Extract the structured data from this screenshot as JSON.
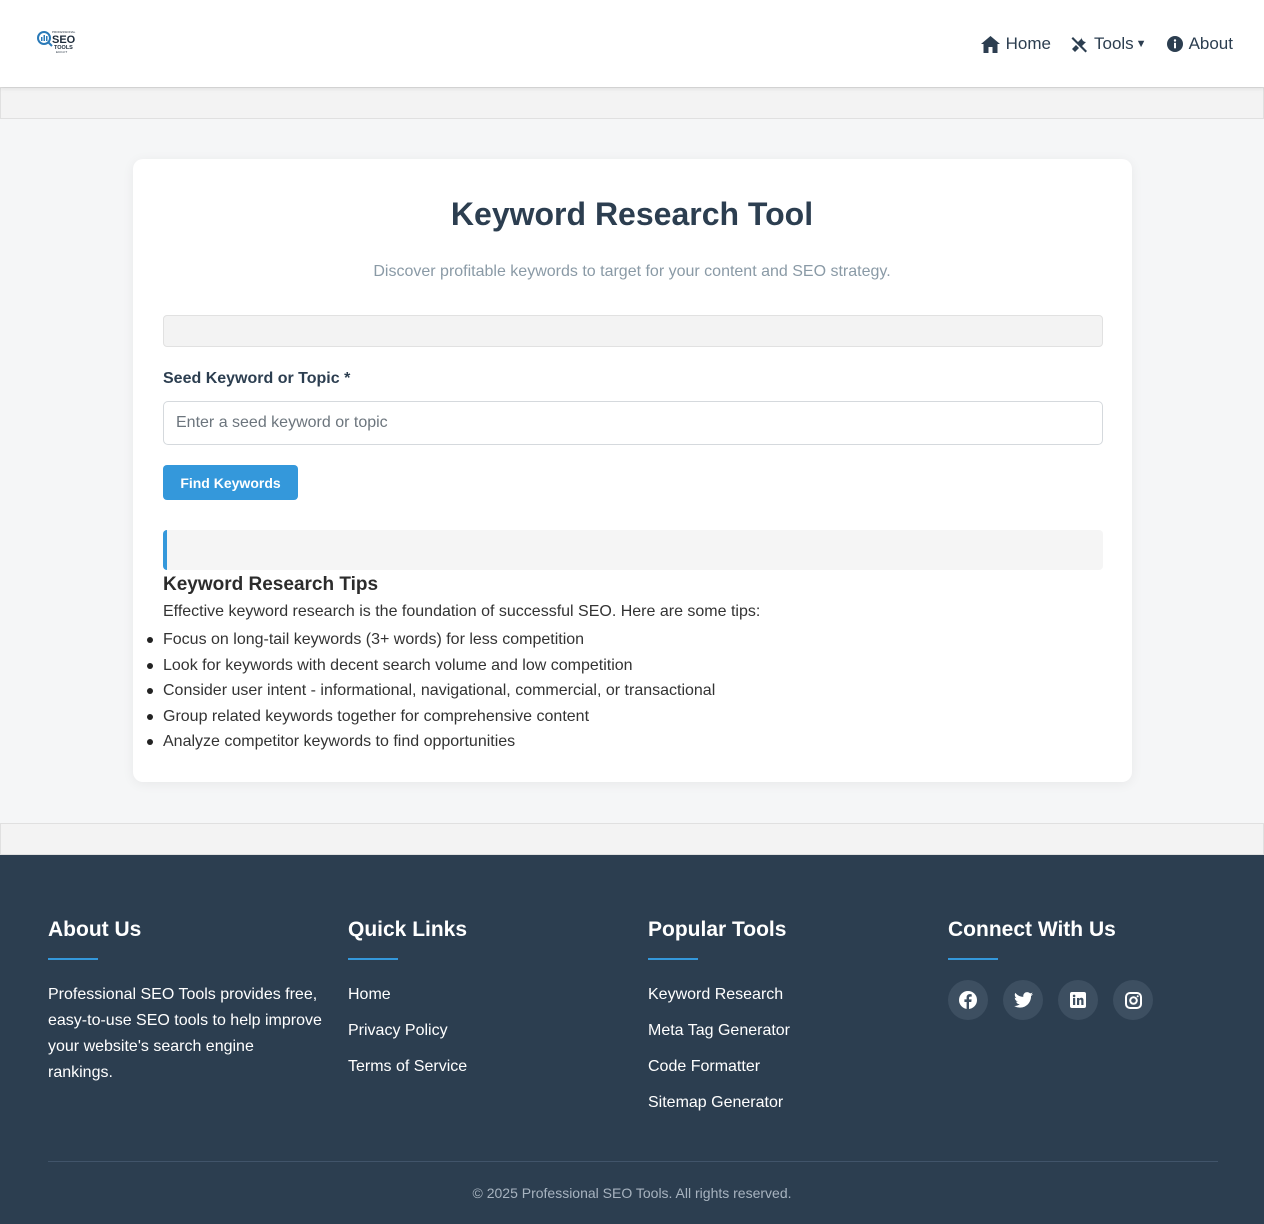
{
  "header": {
    "logo_text": "SEO TOOLS",
    "nav": [
      {
        "label": "Home",
        "icon": "home-icon"
      },
      {
        "label": "Tools",
        "icon": "tools-icon"
      },
      {
        "label": "About",
        "icon": "info-icon"
      }
    ]
  },
  "main": {
    "title": "Keyword Research Tool",
    "subtitle": "Discover profitable keywords to target for your content and SEO strategy.",
    "field_label": "Seed Keyword or Topic *",
    "input_placeholder": "Enter a seed keyword or topic",
    "input_value": "",
    "button_label": "Find Keywords",
    "tips": {
      "title": "Keyword Research Tips",
      "intro": "Effective keyword research is the foundation of successful SEO. Here are some tips:",
      "items": [
        "Focus on long-tail keywords (3+ words) for less competition",
        "Look for keywords with decent search volume and low competition",
        "Consider user intent - informational, navigational, commercial, or transactional",
        "Group related keywords together for comprehensive content",
        "Analyze competitor keywords to find opportunities"
      ]
    }
  },
  "footer": {
    "about": {
      "title": "About Us",
      "text": "Professional SEO Tools provides free, easy-to-use SEO tools to help improve your website's search engine rankings."
    },
    "quick_links": {
      "title": "Quick Links",
      "items": [
        "Home",
        "Privacy Policy",
        "Terms of Service"
      ]
    },
    "popular_tools": {
      "title": "Popular Tools",
      "items": [
        "Keyword Research",
        "Meta Tag Generator",
        "Code Formatter",
        "Sitemap Generator"
      ]
    },
    "connect": {
      "title": "Connect With Us",
      "socials": [
        "facebook-icon",
        "twitter-icon",
        "linkedin-icon",
        "instagram-icon"
      ]
    },
    "copyright": "© 2025 Professional SEO Tools. All rights reserved."
  },
  "colors": {
    "primary": "#3498db",
    "dark": "#2c3e50",
    "footer_bg": "#2c3e50"
  }
}
